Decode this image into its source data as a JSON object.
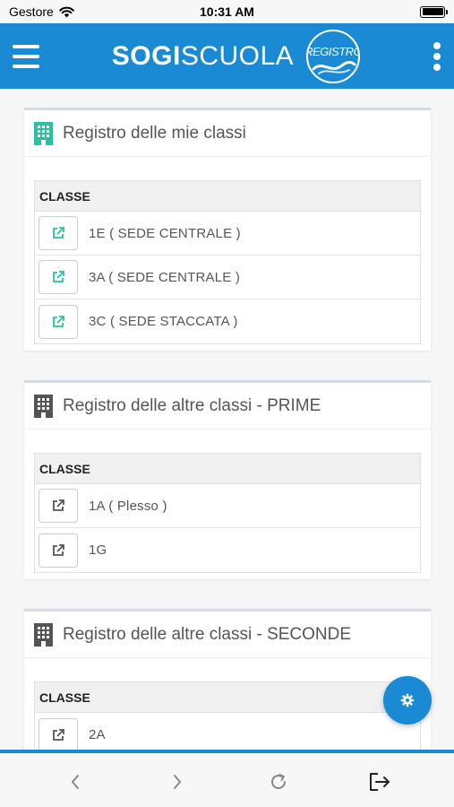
{
  "status_bar": {
    "carrier": "Gestore",
    "time": "10:31 AM",
    "battery_level": 1.0
  },
  "header": {
    "brand_bold": "SOGI",
    "brand_regular": "SCUOLA",
    "logo_text": "REGISTRO",
    "menu_icon": "hamburger-menu-icon",
    "more_icon": "kebab-menu-icon"
  },
  "colors": {
    "primary": "#1a8ad4",
    "accent_teal": "#2bbfa4",
    "icon_gray": "#555555"
  },
  "sections": [
    {
      "title": "Registro delle mie classi",
      "icon": "building-icon",
      "icon_color": "#2bbfa4",
      "column_header": "CLASSE",
      "rows": [
        "1E ( SEDE CENTRALE )",
        "3A ( SEDE CENTRALE )",
        "3C ( SEDE STACCATA )"
      ]
    },
    {
      "title": "Registro delle altre classi - PRIME",
      "icon": "building-icon",
      "icon_color": "#555555",
      "column_header": "CLASSE",
      "rows": [
        "1A ( Plesso )",
        "1G"
      ]
    },
    {
      "title": "Registro delle altre classi - SECONDE",
      "icon": "building-icon",
      "icon_color": "#555555",
      "column_header": "CLASSE",
      "rows": [
        "2A"
      ]
    }
  ],
  "fab_icon": "gear-icon",
  "bottom_nav": {
    "items": [
      "back-icon",
      "forward-icon",
      "reload-icon",
      "logout-icon"
    ]
  }
}
